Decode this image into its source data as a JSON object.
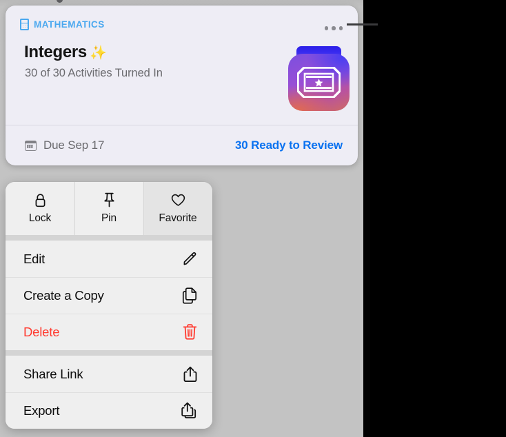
{
  "card": {
    "subject": "MATHEMATICS",
    "subject_icon": "calculator-icon",
    "title": "Integers",
    "title_emoji": "✨",
    "progress": "30 of 30 Activities Turned In",
    "more_icon": "ellipsis-icon",
    "app_icon": "schoolwork-app-icon",
    "due_icon": "calendar-icon",
    "due_label": "Due Sep 17",
    "review_label": "30 Ready to Review",
    "accent_color": "#4aa8ef",
    "link_color": "#0a72f0",
    "background_color": "#eeedf5"
  },
  "menu": {
    "quick_actions": [
      {
        "label": "Lock",
        "icon": "lock-icon"
      },
      {
        "label": "Pin",
        "icon": "pin-icon"
      },
      {
        "label": "Favorite",
        "icon": "heart-icon"
      }
    ],
    "groups": [
      {
        "items": [
          {
            "label": "Edit",
            "icon": "pencil-icon",
            "destructive": false
          },
          {
            "label": "Create a Copy",
            "icon": "duplicate-icon",
            "destructive": false
          },
          {
            "label": "Delete",
            "icon": "trash-icon",
            "destructive": true
          }
        ]
      },
      {
        "items": [
          {
            "label": "Share Link",
            "icon": "share-icon",
            "destructive": false
          },
          {
            "label": "Export",
            "icon": "export-icon",
            "destructive": false
          }
        ]
      }
    ],
    "destructive_color": "#ff3b30"
  }
}
